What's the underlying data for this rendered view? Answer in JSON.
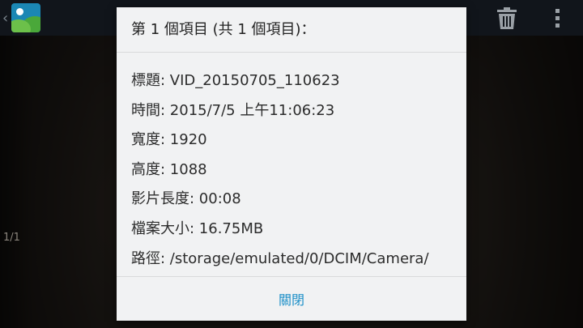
{
  "background": {
    "page_indicator": "1/1"
  },
  "action_bar": {
    "icons": [
      "back-caret-icon",
      "gallery-app-icon",
      "trash-icon",
      "overflow-menu-icon"
    ]
  },
  "dialog": {
    "title": "第 1 個項目 (共 1 個項目)：",
    "rows": [
      "標題: VID_20150705_110623",
      "時間: 2015/7/5 上午11:06:23",
      "寬度: 1920",
      "高度: 1088",
      "影片長度: 00:08",
      "檔案大小: 16.75MB",
      "路徑: /storage/emulated/0/DCIM/Camera/"
    ],
    "close_label": "關閉"
  },
  "colors": {
    "action_bar": "#11151b",
    "dialog_bg": "#f1f2f3",
    "accent": "#1b8fc8",
    "app_icon_bg": "#1b87b4"
  }
}
